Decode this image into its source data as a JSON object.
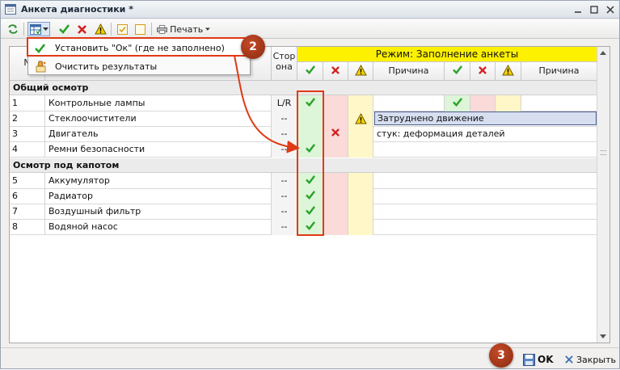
{
  "window": {
    "title": "Анкета диагностики *"
  },
  "toolbar": {
    "print_label": "Печать"
  },
  "menu": {
    "items": [
      {
        "label": "Установить \"Ок\" (где не заполнено)"
      },
      {
        "label": "Очистить результаты"
      }
    ]
  },
  "grid": {
    "headers": {
      "no": "N",
      "side_line1": "Стор",
      "side_line2": "она",
      "mode": "Режим: Заполнение анкеты",
      "reason": "Причина",
      "reason2": "Причина"
    },
    "groups": [
      {
        "title": "Общий осмотр"
      },
      {
        "title": "Осмотр под капотом"
      }
    ],
    "rows": [
      {
        "no": "1",
        "name": "Контрольные лампы",
        "side": "L/R",
        "result": "ok",
        "reason": "",
        "result2": "ok",
        "reason2": ""
      },
      {
        "no": "2",
        "name": "Стеклоочистители",
        "side": "--",
        "result": "warn",
        "reason": "Затруднено движение",
        "result2": "",
        "reason2": ""
      },
      {
        "no": "3",
        "name": "Двигатель",
        "side": "--",
        "result": "x",
        "reason": "стук: деформация деталей",
        "result2": "",
        "reason2": ""
      },
      {
        "no": "4",
        "name": "Ремни безопасности",
        "side": "--",
        "result": "ok",
        "reason": "",
        "result2": "",
        "reason2": ""
      },
      {
        "no": "5",
        "name": "Аккумулятор",
        "side": "--",
        "result": "ok",
        "reason": "",
        "result2": "",
        "reason2": ""
      },
      {
        "no": "6",
        "name": "Радиатор",
        "side": "--",
        "result": "ok",
        "reason": "",
        "result2": "",
        "reason2": ""
      },
      {
        "no": "7",
        "name": "Воздушный фильтр",
        "side": "--",
        "result": "ok",
        "reason": "",
        "result2": "",
        "reason2": ""
      },
      {
        "no": "8",
        "name": "Водяной насос",
        "side": "--",
        "result": "ok",
        "reason": "",
        "result2": "",
        "reason2": ""
      }
    ]
  },
  "footer": {
    "ok_label": "OK",
    "close_label": "Закрыть"
  },
  "annotations": {
    "badge2": "2",
    "badge3": "3"
  },
  "colors": {
    "mode_header": "#fdf100",
    "highlight": "#e03a16",
    "badge": "#9b3214"
  }
}
